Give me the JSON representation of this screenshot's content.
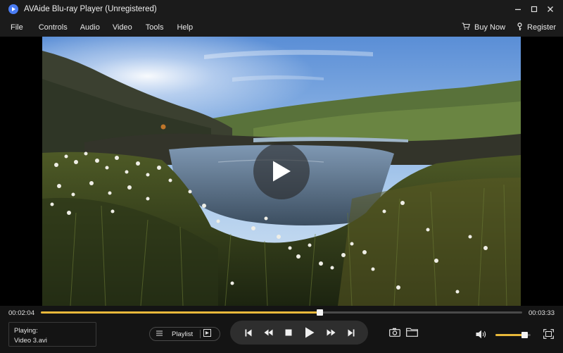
{
  "app": {
    "title": "AVAide Blu-ray Player (Unregistered)"
  },
  "menu": {
    "items": [
      "File",
      "Controls",
      "Audio",
      "Video",
      "Tools",
      "Help"
    ],
    "buy_label": "Buy Now",
    "register_label": "Register"
  },
  "player": {
    "current_time": "00:02:04",
    "total_time": "00:03:33",
    "progress": 0.58,
    "volume": 0.82,
    "now_playing_label": "Playing:",
    "now_playing_file": "Video 3.avi",
    "playlist_label": "Playlist"
  },
  "colors": {
    "accent": "#e8b83a",
    "background": "#121212",
    "bar": "#1b1b1b"
  },
  "icons": {
    "logo": "play-logo-icon",
    "minimize": "minimize-icon",
    "maximize": "maximize-icon",
    "close": "close-icon",
    "cart": "cart-icon",
    "register": "key-icon",
    "play_overlay": "play-icon",
    "playlist": "list-icon",
    "playlist_add": "add-icon",
    "previous": "skip-previous-icon",
    "rewind": "rewind-icon",
    "stop": "stop-icon",
    "play": "play-icon",
    "forward": "fast-forward-icon",
    "next": "skip-next-icon",
    "snapshot": "camera-icon",
    "open_folder": "folder-icon",
    "volume": "volume-icon",
    "fullscreen": "fullscreen-icon"
  }
}
